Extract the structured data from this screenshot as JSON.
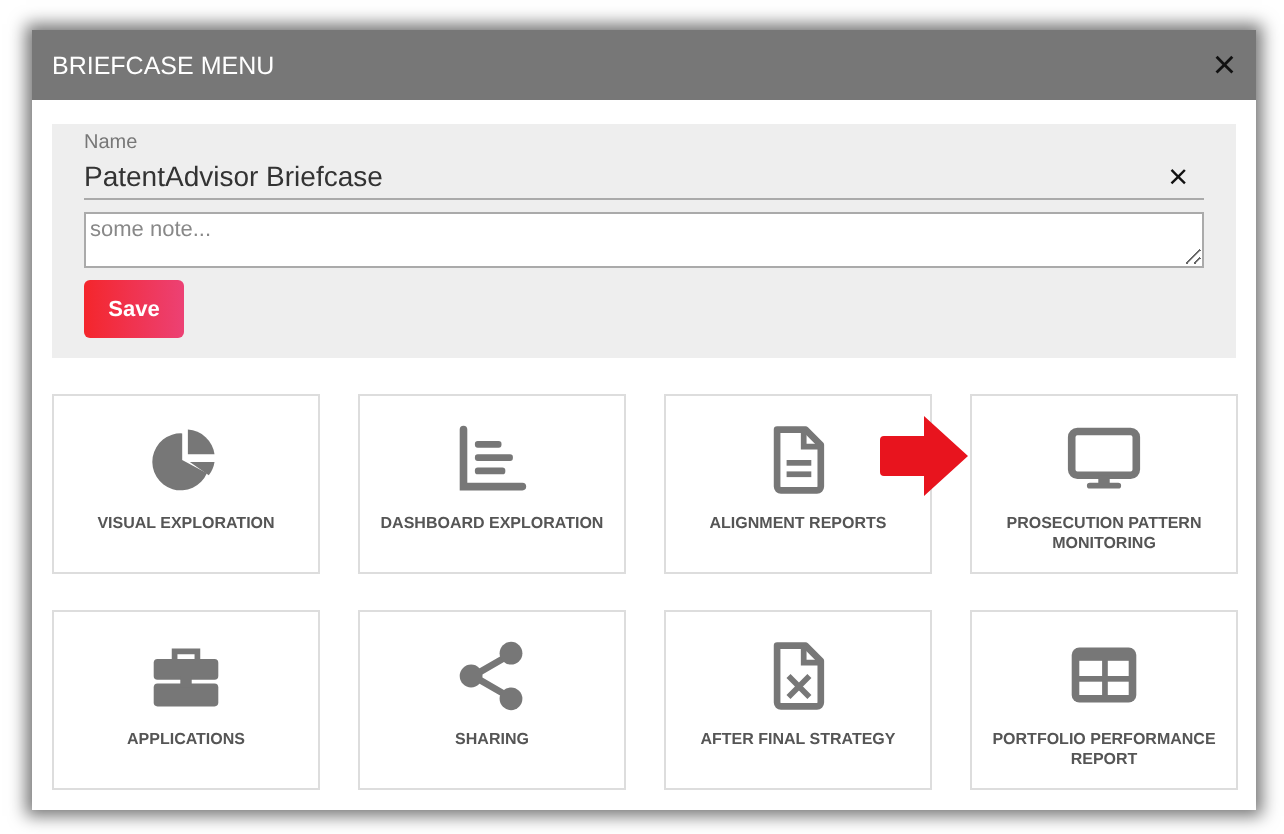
{
  "dialog": {
    "title": "BRIEFCASE MENU",
    "close": "×"
  },
  "form": {
    "name_label": "Name",
    "name_value": "PatentAdvisor Briefcase",
    "clear": "×",
    "note_placeholder": "some note...",
    "save": "Save"
  },
  "tiles": [
    {
      "label": "VISUAL EXPLORATION",
      "kind": "pie"
    },
    {
      "label": "DASHBOARD EXPLORATION",
      "kind": "bars"
    },
    {
      "label": "ALIGNMENT REPORTS",
      "kind": "file"
    },
    {
      "label": "PROSECUTION PATTERN MONITORING",
      "kind": "monitor"
    },
    {
      "label": "APPLICATIONS",
      "kind": "briefcase"
    },
    {
      "label": "SHARING",
      "kind": "share"
    },
    {
      "label": "AFTER FINAL STRATEGY",
      "kind": "filex"
    },
    {
      "label": "PORTFOLIO PERFORMANCE REPORT",
      "kind": "table"
    }
  ]
}
